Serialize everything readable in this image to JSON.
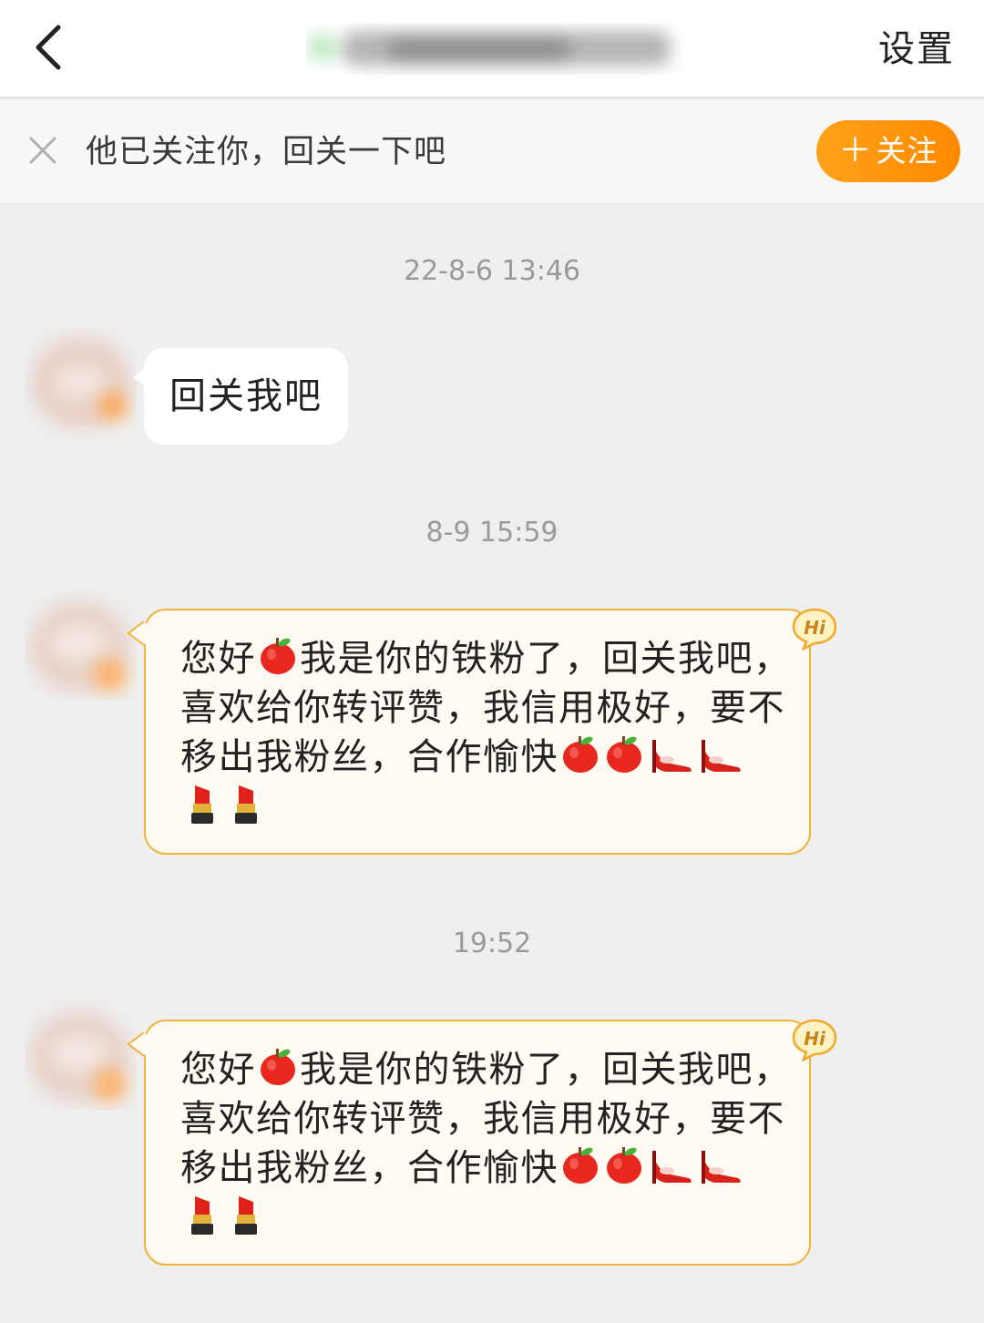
{
  "header": {
    "title": "",
    "settings_label": "设置"
  },
  "banner": {
    "text": "他已关注你，回关一下吧",
    "follow_label": "关注"
  },
  "messages": [
    {
      "timestamp": "22-8-6 13:46",
      "text": "回关我吧"
    },
    {
      "timestamp": "8-9 15:59",
      "lines": [
        "您好",
        "我是你的铁粉了，回关我吧，",
        "喜欢给你转评赞，我信用极好，要不",
        "移出我粉丝，合作愉快"
      ],
      "badge": "Hi"
    },
    {
      "timestamp": "19:52",
      "lines": [
        "您好",
        "我是你的铁粉了，回关我吧，",
        "喜欢给你转评赞，我信用极好，要不",
        "移出我粉丝，合作愉快"
      ],
      "badge": "Hi"
    }
  ],
  "colors": {
    "accent": "#ff9a0f",
    "bubble_border": "#f1b23f",
    "bubble_bg": "#fffbf2"
  },
  "icons": [
    "back-arrow-icon",
    "close-icon",
    "plus-icon",
    "apple-emoji",
    "high-heel-emoji",
    "lipstick-emoji",
    "hi-badge-icon"
  ]
}
